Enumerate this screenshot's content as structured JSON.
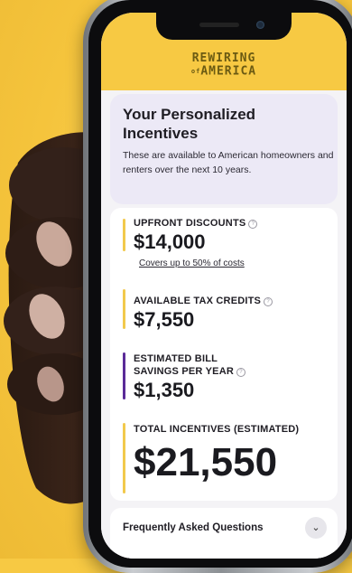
{
  "header": {
    "logo_line1": "REWIRING",
    "logo_of": "of",
    "logo_line2": "AMERICA"
  },
  "intro": {
    "title": "Your Personalized Incentives",
    "subtitle": "These are available to American homeowners and renters over the next 10 years."
  },
  "stats": {
    "upfront": {
      "label": "UPFRONT DISCOUNTS",
      "value": "$14,000",
      "link": "Covers up to 50% of costs"
    },
    "tax": {
      "label": "AVAILABLE TAX CREDITS",
      "value": "$7,550"
    },
    "savings": {
      "label_line1": "ESTIMATED BILL",
      "label_line2": "SAVINGS PER YEAR",
      "value": "$1,350"
    },
    "total": {
      "label": "TOTAL INCENTIVES (ESTIMATED)",
      "value": "$21,550"
    }
  },
  "faq": {
    "label": "Frequently Asked Questions",
    "icon": "chevron-down-icon"
  },
  "colors": {
    "background": "#f7c943",
    "accent_yellow": "#f2c94c",
    "accent_purple": "#5b2b98",
    "intro_bg": "#ece9f6"
  }
}
